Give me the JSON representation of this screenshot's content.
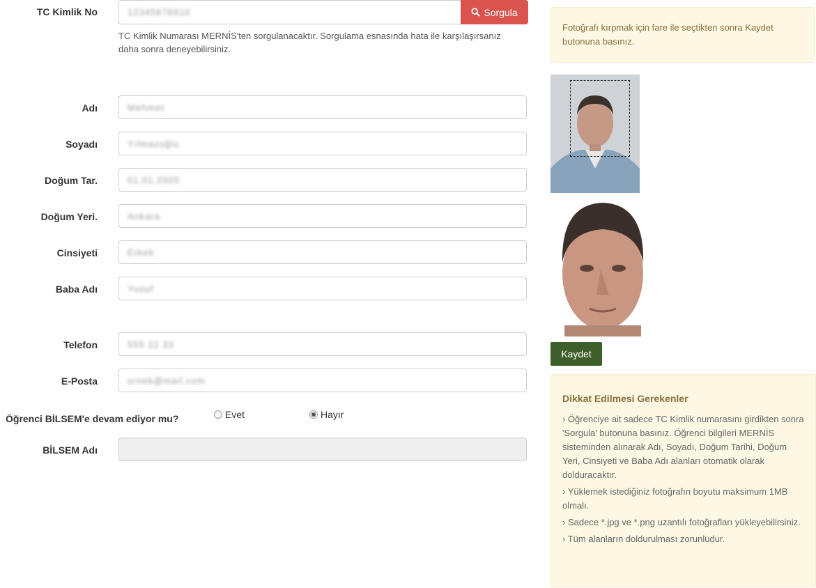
{
  "form": {
    "tc": {
      "label": "TC Kimlik No",
      "value": "12345678910",
      "button": "Sorgula",
      "help": "TC Kimlik Numarası MERNİS'ten sorgulanacaktır. Sorgulama esnasında hata ile karşılaşırsanız daha sonra deneyebilirsiniz."
    },
    "adi": {
      "label": "Adı",
      "value": "Mehmet"
    },
    "soyadi": {
      "label": "Soyadı",
      "value": "Yılmazoğlu"
    },
    "dogum_tar": {
      "label": "Doğum Tar.",
      "value": "01.01.2005"
    },
    "dogum_yeri": {
      "label": "Doğum Yeri.",
      "value": "Ankara"
    },
    "cinsiyeti": {
      "label": "Cinsiyeti",
      "value": "Erkek"
    },
    "baba_adi": {
      "label": "Baba Adı",
      "value": "Yusuf"
    },
    "telefon": {
      "label": "Telefon",
      "value": "555 22 33"
    },
    "eposta": {
      "label": "E-Posta",
      "value": "ornek@mail.com"
    },
    "bilsem_q": {
      "label": "Öğrenci BİLSEM'e devam ediyor mu?",
      "option_yes": "Evet",
      "option_no": "Hayır",
      "selected": "Hayır"
    },
    "bilsem_adi": {
      "label": "BİLSEM Adı",
      "value": ""
    }
  },
  "photo": {
    "hint": "Fotoğrafı kırpmak için fare ile seçtikten sonra Kaydet butonuna basınız.",
    "save_button": "Kaydet"
  },
  "notes": {
    "title": "Dikkat Edilmesi Gerekenler",
    "items": [
      "› Öğrenciye ait sadece TC Kimlik numarasını girdikten sonra 'Sorgula' butonuna basınız. Öğrenci bilgileri MERNİS sisteminden alınarak Adı, Soyadı, Doğum Tarihi, Doğum Yeri, Cinsiyeti ve Baba Adı alanları otomatik olarak dolduracaktır.",
      "› Yüklemek istediğiniz fotoğrafın boyutu maksimum 1MB olmalı.",
      "› Sadece *.jpg ve *.png uzantılı fotoğrafları yükleyebilirsiniz.",
      "› Tüm alanların doldurulması zorunludur."
    ]
  },
  "colors": {
    "sorgula": "#d9534f",
    "kaydet": "#3e5f2a",
    "alert_bg": "#fcf8e3"
  },
  "icons": {
    "search": "search-icon"
  }
}
